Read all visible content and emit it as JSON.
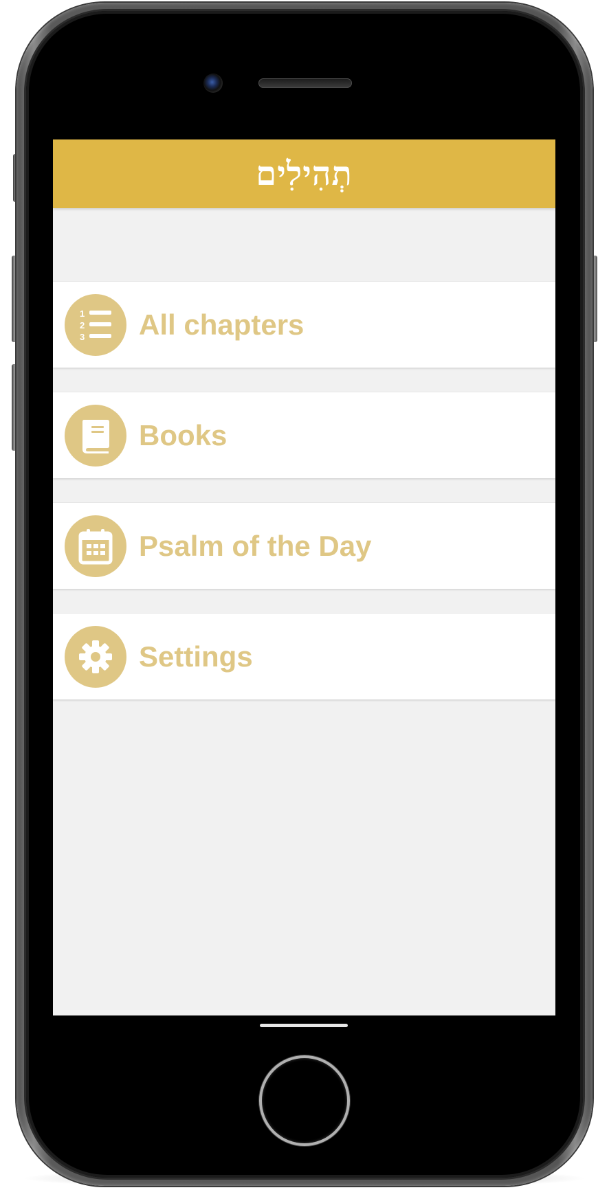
{
  "app": {
    "title": "תְהִילִים",
    "accent_color": "#dfb746",
    "menu_color": "#dfc785"
  },
  "menu": {
    "items": [
      {
        "label": "All chapters",
        "icon": "numbered-list-icon"
      },
      {
        "label": "Books",
        "icon": "book-icon"
      },
      {
        "label": "Psalm of the Day",
        "icon": "calendar-icon"
      },
      {
        "label": "Settings",
        "icon": "gear-icon"
      }
    ]
  }
}
